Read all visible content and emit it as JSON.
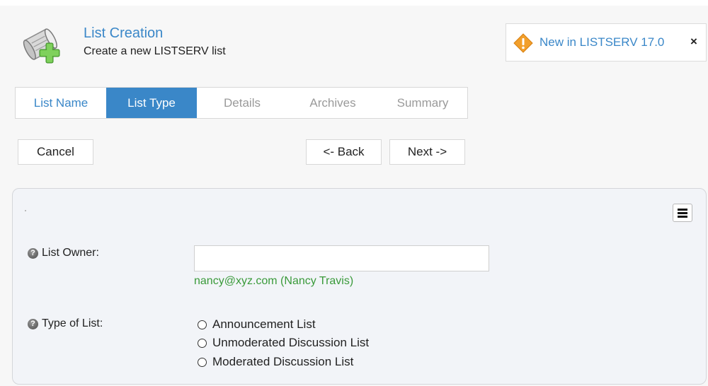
{
  "header": {
    "title": "List Creation",
    "subtitle": "Create a new LISTSERV list",
    "icon": "scroll-add-icon"
  },
  "whats_new": {
    "link_label": "New in LISTSERV 17.0",
    "close_label": "×",
    "icon": "warning-diamond-icon"
  },
  "steps": [
    {
      "label": "List Name",
      "state": "link"
    },
    {
      "label": "List Type",
      "state": "active"
    },
    {
      "label": "Details",
      "state": "disabled"
    },
    {
      "label": "Archives",
      "state": "disabled"
    },
    {
      "label": "Summary",
      "state": "disabled"
    }
  ],
  "buttons": {
    "cancel": "Cancel",
    "back": "<- Back",
    "next": "Next ->"
  },
  "form": {
    "menu_icon": "hamburger-menu-icon",
    "list_owner": {
      "label": "List Owner:",
      "value": "",
      "hint": "nancy@xyz.com (Nancy Travis)"
    },
    "type_of_list": {
      "label": "Type of List:",
      "options": [
        "Announcement List",
        "Unmoderated Discussion List",
        "Moderated Discussion List"
      ]
    },
    "help_glyph": "?"
  },
  "colors": {
    "accent": "#3a87c8",
    "hint_green": "#3a9a3a",
    "disabled_text": "#9a9a9a"
  }
}
